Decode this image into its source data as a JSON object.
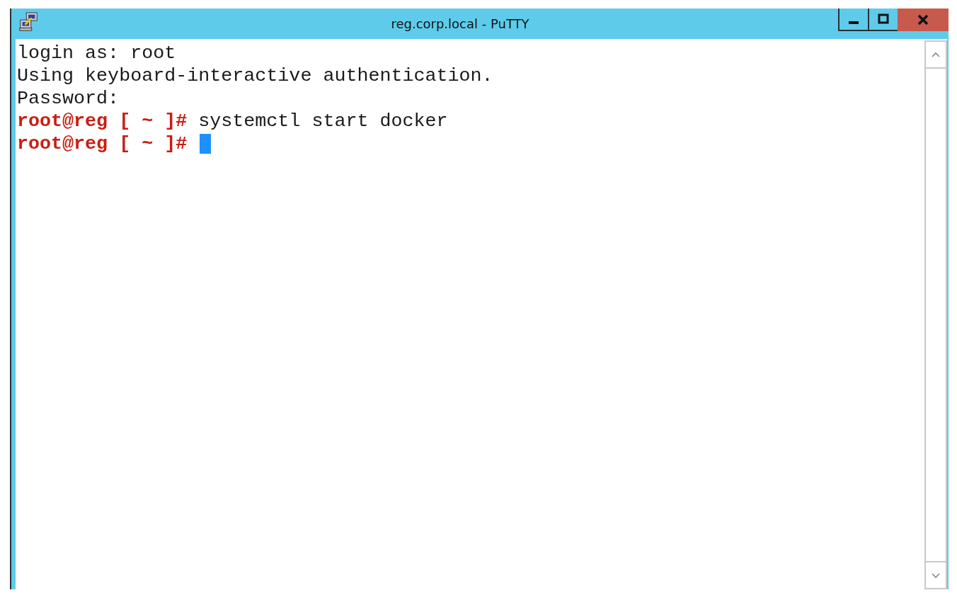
{
  "window": {
    "title": "reg.corp.local - PuTTY"
  },
  "terminal": {
    "lines": [
      {
        "segments": [
          {
            "kind": "output",
            "text": "login as: root"
          }
        ]
      },
      {
        "segments": [
          {
            "kind": "output",
            "text": "Using keyboard-interactive authentication."
          }
        ]
      },
      {
        "segments": [
          {
            "kind": "output",
            "text": "Password:"
          }
        ]
      },
      {
        "segments": [
          {
            "kind": "prompt",
            "text": "root@reg [ ~ ]#"
          },
          {
            "kind": "output",
            "text": " systemctl start docker"
          }
        ]
      },
      {
        "segments": [
          {
            "kind": "prompt",
            "text": "root@reg [ ~ ]#"
          },
          {
            "kind": "cursor"
          }
        ]
      }
    ]
  }
}
